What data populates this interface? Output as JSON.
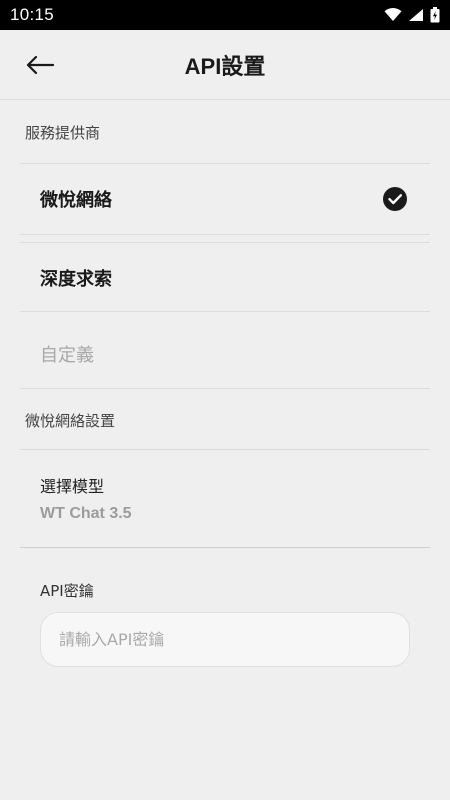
{
  "status_bar": {
    "time": "10:15"
  },
  "app_bar": {
    "title": "API設置"
  },
  "provider_section": {
    "header": "服務提供商",
    "options": [
      {
        "label": "微悅網絡",
        "selected": true,
        "enabled": true
      },
      {
        "label": "深度求索",
        "selected": false,
        "enabled": true
      },
      {
        "label": "自定義",
        "selected": false,
        "enabled": false
      }
    ]
  },
  "settings_section": {
    "header": "微悅網絡設置",
    "model_label": "選擇模型",
    "model_value": "WT Chat 3.5"
  },
  "api_key": {
    "label": "API密鑰",
    "placeholder": "請輸入API密鑰",
    "value": ""
  },
  "icons": {
    "back": "arrow-left-icon",
    "check": "check-circle-icon",
    "wifi": "wifi-icon",
    "signal": "signal-icon",
    "battery": "battery-icon"
  },
  "colors": {
    "background": "#efefef",
    "status_bar": "#000000",
    "disabled_text": "#a8a8a8",
    "check": "#1a1a1a"
  }
}
